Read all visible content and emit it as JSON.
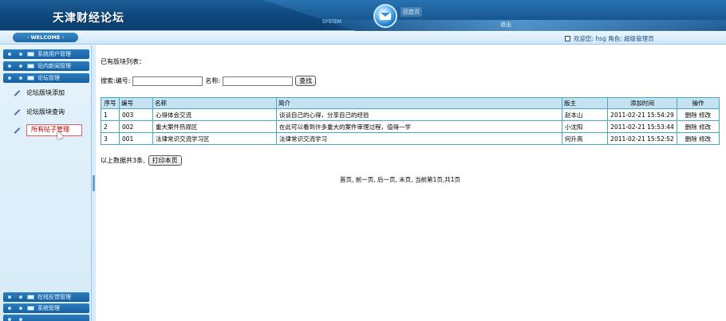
{
  "header": {
    "site_title": "天津财经论坛",
    "nav_system": "SYSTEM",
    "home_link": "回首页",
    "logout_link": "退出"
  },
  "welcome_bar": {
    "welcome_label": "· WELCOME ·",
    "user_greeting": "欢迎您: hsg 角色: 超级管理员"
  },
  "sidebar": {
    "top_menus": [
      {
        "label": "系统用户管理"
      },
      {
        "label": "站内新闻管理"
      },
      {
        "label": "论坛管理"
      }
    ],
    "submenu": [
      {
        "label": "论坛版块添加"
      },
      {
        "label": "论坛版块查询"
      },
      {
        "label": "所有帖子管理"
      }
    ],
    "bottom_menus": [
      {
        "label": "在线反馈管理"
      },
      {
        "label": "系统管理"
      }
    ]
  },
  "content": {
    "list_title": "已有版块列表：",
    "search": {
      "label": "搜索:",
      "id_label": "编号:",
      "id_value": "",
      "name_label": "名称:",
      "name_value": "",
      "search_button": "查找"
    },
    "table": {
      "headers": [
        "序号",
        "编号",
        "名称",
        "简介",
        "版主",
        "添加时间",
        "操作"
      ],
      "rows": [
        {
          "seq": "1",
          "id": "003",
          "name": "心得体会交流",
          "intro": "谈谈自己的心得，分享自己的经验",
          "moderator": "赵本山",
          "time": "2011-02-21 15:54:29",
          "delete": "删除",
          "edit": "修改"
        },
        {
          "seq": "2",
          "id": "002",
          "name": "重大案件热观区",
          "intro": "在此可以看到许多重大的案件审理过程，值得一学",
          "moderator": "小沈阳",
          "time": "2011-02-21 15:53:44",
          "delete": "删除",
          "edit": "修改"
        },
        {
          "seq": "3",
          "id": "001",
          "name": "法律常识交流学习区",
          "intro": "法律常识交流学习",
          "moderator": "何升高",
          "time": "2011-02-21 15:52:52",
          "delete": "删除",
          "edit": "修改"
        }
      ]
    },
    "count_text": "以上数据共3条,",
    "print_button": "打印本页",
    "pager": "首页, 前一页, 后一页, 末页, 当前第1页,共1页"
  }
}
